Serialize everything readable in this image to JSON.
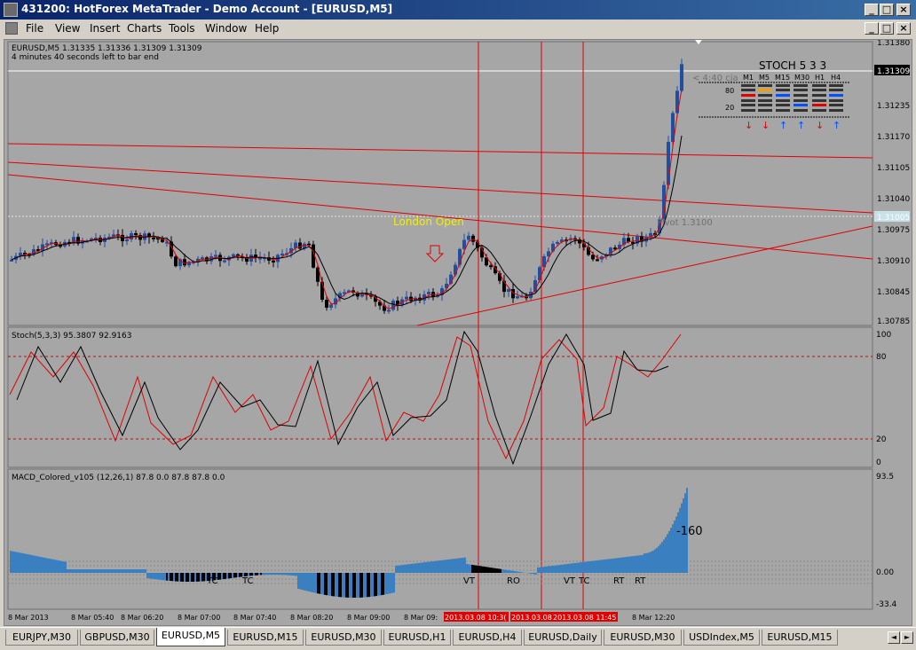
{
  "window": {
    "title": "431200: HotForex MetaTrader - Demo Account - [EURUSD,M5]",
    "min_glyph": "_",
    "max_glyph": "□",
    "close_glyph": "×"
  },
  "menu": {
    "items": [
      "File",
      "View",
      "Insert",
      "Charts",
      "Tools",
      "Window",
      "Help"
    ]
  },
  "chart": {
    "header_line1": "EURUSD,M5  1.31335 1.31336 1.31309 1.31309",
    "header_line2": "4 minutes 40 seconds left to bar end",
    "countdown": "< 4:40 cja",
    "current_price": "1.31309",
    "pivot_price_box": "1.31005",
    "pivot_label": "Pivot 1.3100",
    "london_open_label": "London Open",
    "price_axis": [
      "1.31380",
      "1.31309",
      "1.31235",
      "1.31170",
      "1.31105",
      "1.31040",
      "1.30975",
      "1.30910",
      "1.30845",
      "1.30785"
    ],
    "colors": {
      "background": "#a6a6a6",
      "bull": "#1f4fa0",
      "bear": "#000000",
      "trend": "#e00000",
      "grid_line": "#ffffff"
    }
  },
  "stoch_panel": {
    "title": "STOCH  5 3 3",
    "timeframes": [
      "M1",
      "M5",
      "M15",
      "M30",
      "H1",
      "H4"
    ],
    "level_80": "80",
    "level_20": "20",
    "arrows": [
      "down",
      "down",
      "up",
      "up",
      "down",
      "up"
    ]
  },
  "stoch": {
    "header": "Stoch(5,3,3) 95.3807 92.9163",
    "axis": [
      "100",
      "80",
      "20",
      "0"
    ]
  },
  "macd": {
    "header": "MACD_Colored_v105 (12,26,1) 87.8 0.0 87.8 87.8 0.0",
    "axis_top": "93.5",
    "axis_zero": "0.00",
    "axis_bottom": "-33.4",
    "big_value": "-160",
    "labels": [
      "TC",
      "TC",
      "VT",
      "RO",
      "VT",
      "TC",
      "RT",
      "RT"
    ]
  },
  "time_axis": [
    "8 Mar 2013",
    "8 Mar 05:40",
    "8 Mar 06:20",
    "8 Mar 07:00",
    "8 Mar 07:40",
    "8 Mar 08:20",
    "8 Mar 09:00",
    "8 Mar 09:",
    "2013.03.08 10:3(",
    "2013.03.08 11:05",
    "2013.03.08 11:45",
    "8 Mar 12:20"
  ],
  "tabs": [
    "EURJPY,M30",
    "GBPUSD,M30",
    "EURUSD,M5",
    "EURUSD,M15",
    "EURUSD,M30",
    "EURUSD,H1",
    "EURUSD,H4",
    "EURUSD,Daily",
    "EURUSD,M30",
    "USDIndex,M5",
    "EURUSD,M15"
  ],
  "active_tab": "EURUSD,M5"
}
